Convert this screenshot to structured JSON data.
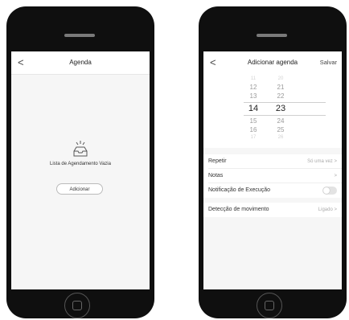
{
  "left_screen": {
    "title": "Agenda",
    "back_glyph": "<",
    "empty_icon": "empty-tray-icon",
    "empty_text": "Lista de Agendamento Vazia",
    "add_button": "Adicionar"
  },
  "right_screen": {
    "title": "Adicionar agenda",
    "save": "Salvar",
    "back_glyph": "<",
    "picker": {
      "hours": [
        "11",
        "12",
        "13",
        "14",
        "15",
        "16",
        "17"
      ],
      "minutes": [
        "20",
        "21",
        "22",
        "23",
        "24",
        "25",
        "26"
      ],
      "selected_hour": "14",
      "selected_minute": "23"
    },
    "rows": [
      {
        "label": "Repetir",
        "value": "Só uma vez",
        "chevron": ">"
      },
      {
        "label": "Notas",
        "value": "",
        "chevron": ">"
      },
      {
        "label": "Notificação de Execução",
        "toggle": false
      },
      {
        "label": "Detecção de movimento",
        "value": "Ligado",
        "chevron": ">"
      }
    ]
  },
  "colors": {
    "phone_body": "#0f0f0f",
    "screen_bg": "#f6f6f6",
    "toggle_off": "#e3e3e3"
  }
}
